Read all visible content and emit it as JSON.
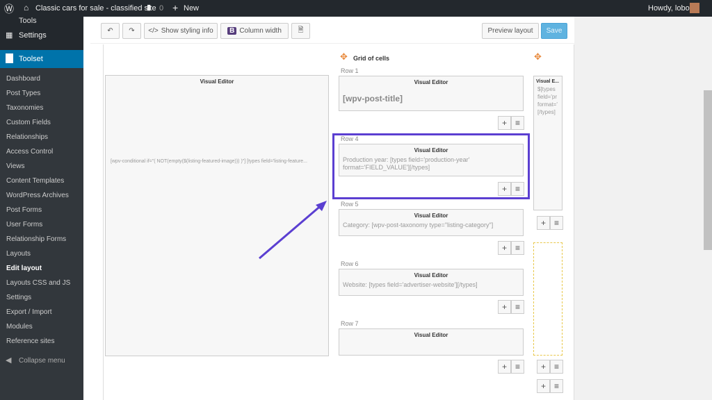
{
  "topbar": {
    "site": "Classic cars for sale - classified site",
    "comments": "0",
    "new": "New",
    "howdy": "Howdy, lobo"
  },
  "sidebar": {
    "tools": "Tools",
    "settings": "Settings",
    "toolset": "Toolset",
    "items": [
      "Dashboard",
      "Post Types",
      "Taxonomies",
      "Custom Fields",
      "Relationships",
      "Access Control",
      "Views",
      "Content Templates",
      "WordPress Archives",
      "Post Forms",
      "User Forms",
      "Relationship Forms",
      "Layouts",
      "Edit layout",
      "Layouts CSS and JS",
      "Settings",
      "Export / Import",
      "Modules",
      "Reference sites"
    ],
    "current": "Edit layout",
    "collapse": "Collapse menu"
  },
  "toolbar": {
    "styling": "Show styling info",
    "column_width": "Column width",
    "preview": "Preview layout",
    "save": "Save"
  },
  "editor": {
    "left_cell": {
      "title": "Visual Editor",
      "content": "[wpv-conditional if=\"( NOT(empty($(listing-featured-image))) )\"] [types field='listing-feature..."
    },
    "grid_title": "Grid of cells",
    "rows": [
      {
        "label": "Row 1",
        "title": "Visual Editor",
        "content": "[wpv-post-title]"
      },
      {
        "label": "Row 4",
        "title": "Visual Editor",
        "content": "Production year: [types field='production-year' format='FIELD_VALUE'][/types]"
      },
      {
        "label": "Row 5",
        "title": "Visual Editor",
        "content": "Category: [wpv-post-taxonomy type=\"listing-category\"]"
      },
      {
        "label": "Row 6",
        "title": "Visual Editor",
        "content": "Website: [types field='advertiser-website'][/types]"
      },
      {
        "label": "Row 7",
        "title": "Visual Editor",
        "content": ""
      }
    ],
    "right_cell": {
      "title": "Visual E...",
      "content": "$[types field='pr format=' [/types]"
    }
  },
  "colors": {
    "accent": "#0073aa",
    "highlight": "#5b3fd1",
    "move": "#e8883a"
  }
}
